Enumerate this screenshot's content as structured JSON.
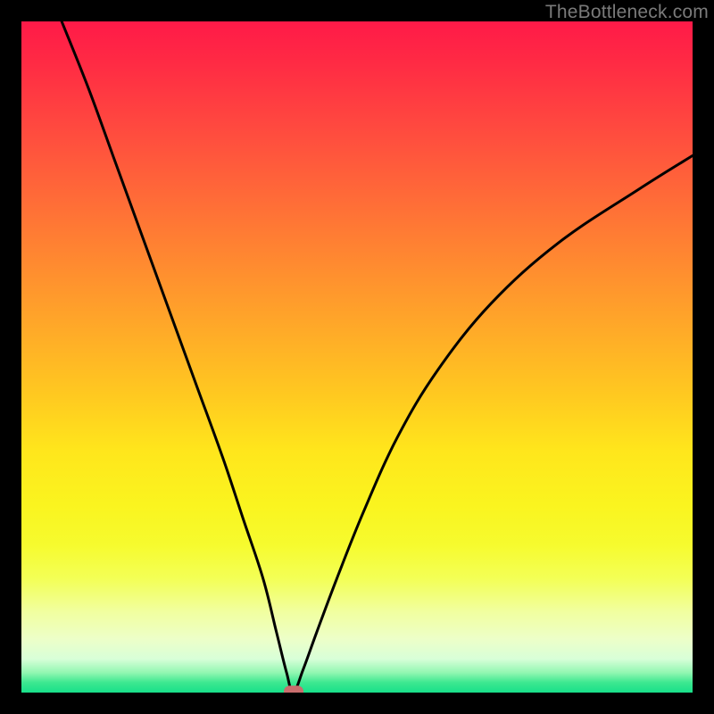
{
  "watermark": "TheBottleneck.com",
  "colors": {
    "background": "#000000",
    "curve": "#000000",
    "marker": "#c96d6d",
    "watermark": "#7a7a7a"
  },
  "chart_data": {
    "type": "line",
    "title": "",
    "xlabel": "",
    "ylabel": "",
    "xlim": [
      0,
      100
    ],
    "ylim": [
      0,
      100
    ],
    "grid": false,
    "legend": false,
    "annotations": [
      {
        "type": "marker",
        "x": 40.5,
        "y": 0,
        "shape": "pill",
        "color": "#c96d6d"
      }
    ],
    "series": [
      {
        "name": "bottleneck-curve",
        "color": "#000000",
        "x": [
          6,
          10,
          14,
          18,
          22,
          26,
          30,
          33,
          36,
          38,
          39.5,
          40.5,
          42,
          44,
          47,
          51,
          56,
          62,
          70,
          80,
          92,
          100
        ],
        "values": [
          100,
          90,
          79,
          68,
          57,
          46,
          35,
          26,
          17,
          9,
          3,
          0,
          3.5,
          9,
          17,
          27,
          38,
          48,
          58,
          67,
          75,
          80
        ]
      }
    ],
    "background_gradient": {
      "direction": "top-to-bottom",
      "stops": [
        {
          "pos": 0.0,
          "color": "#ff1a48"
        },
        {
          "pos": 0.4,
          "color": "#ff8a30"
        },
        {
          "pos": 0.7,
          "color": "#faf41f"
        },
        {
          "pos": 0.92,
          "color": "#edffc8"
        },
        {
          "pos": 1.0,
          "color": "#18e08a"
        }
      ]
    }
  }
}
